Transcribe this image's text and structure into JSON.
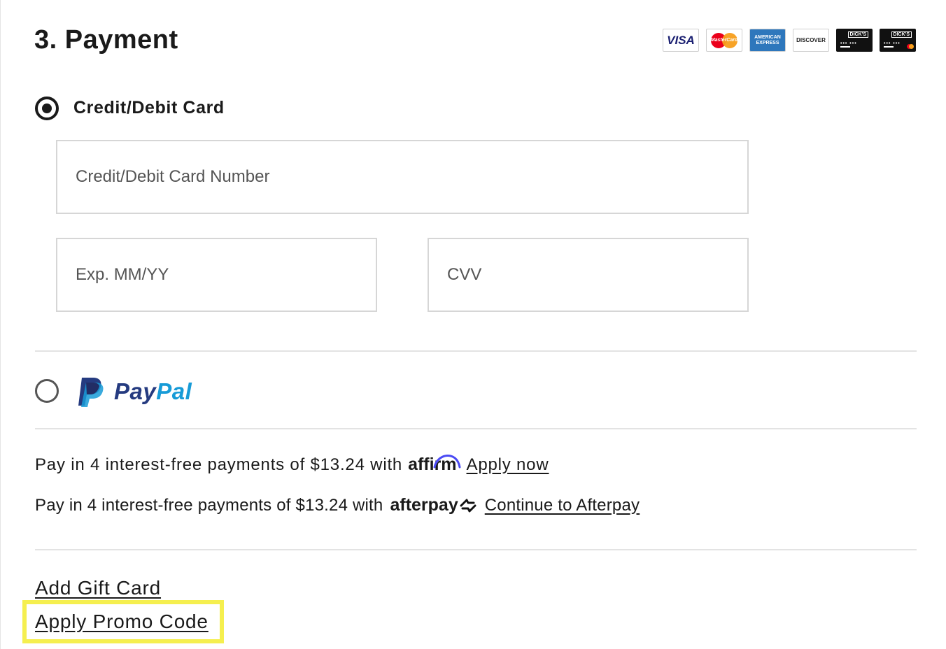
{
  "section": {
    "title": "3. Payment"
  },
  "card_logos": {
    "visa": "VISA",
    "mastercard": "MasterCard",
    "amex": "AMERICAN EXPRESS",
    "discover": "DISCOVER",
    "dicks_card": "DICK'S",
    "dicks_mastercard": "DICK'S"
  },
  "credit_card": {
    "label": "Credit/Debit Card",
    "selected": true,
    "card_number_placeholder": "Credit/Debit Card Number",
    "exp_placeholder": "Exp. MM/YY",
    "cvv_placeholder": "CVV"
  },
  "paypal": {
    "selected": false,
    "logo_pay": "Pay",
    "logo_pal": "Pal"
  },
  "affirm": {
    "text": "Pay in 4 interest-free payments of $13.24 with",
    "brand": "affirm",
    "link": "Apply now"
  },
  "afterpay": {
    "text": "Pay in 4 interest-free payments of $13.24 with",
    "brand": "afterpay",
    "link": "Continue to Afterpay"
  },
  "links": {
    "gift_card": "Add Gift Card",
    "promo_code": "Apply Promo Code"
  },
  "colors": {
    "highlight": "#f5ef4f",
    "paypal_dark": "#253b80",
    "paypal_light": "#179bd7",
    "affirm_arc": "#4a4af4"
  }
}
